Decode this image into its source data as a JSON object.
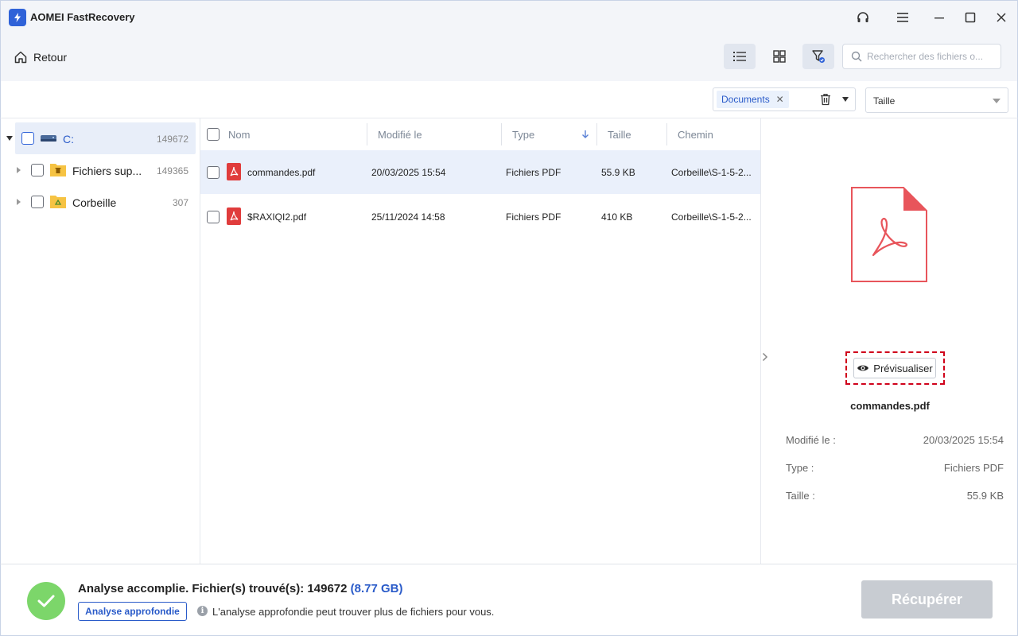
{
  "app": {
    "title": "AOMEI FastRecovery"
  },
  "toolbar": {
    "back_label": "Retour",
    "search_placeholder": "Rechercher des fichiers o..."
  },
  "filter": {
    "chip_label": "Documents",
    "size_select": "Taille"
  },
  "tree": [
    {
      "label": "C:",
      "count": "149672",
      "expanded": true,
      "selected": true
    },
    {
      "label": "Fichiers sup...",
      "count": "149365"
    },
    {
      "label": "Corbeille",
      "count": "307"
    }
  ],
  "columns": {
    "name": "Nom",
    "modified": "Modifié le",
    "type": "Type",
    "size": "Taille",
    "path": "Chemin"
  },
  "files": [
    {
      "name": "commandes.pdf",
      "modified": "20/03/2025 15:54",
      "type": "Fichiers PDF",
      "size": "55.9 KB",
      "path": "Corbeille\\S-1-5-2...",
      "selected": true
    },
    {
      "name": "$RAXIQI2.pdf",
      "modified": "25/11/2024 14:58",
      "type": "Fichiers PDF",
      "size": "410 KB",
      "path": "Corbeille\\S-1-5-2..."
    }
  ],
  "preview": {
    "button_label": "Prévisualiser",
    "file_name": "commandes.pdf",
    "meta": [
      {
        "label": "Modifié le :",
        "value": "20/03/2025 15:54"
      },
      {
        "label": "Type :",
        "value": "Fichiers PDF"
      },
      {
        "label": "Taille :",
        "value": "55.9 KB"
      }
    ]
  },
  "footer": {
    "status": "Analyse accomplie. Fichier(s) trouvé(s): 149672",
    "status_size": "(8.77 GB)",
    "deep_scan_label": "Analyse approfondie",
    "hint": "L'analyse approfondie peut trouver plus de fichiers pour vous.",
    "recover_label": "Récupérer"
  },
  "colors": {
    "accent": "#2f62d8",
    "link": "#2a5bc9",
    "success": "#7cd66a",
    "pdf": "#e03c3c",
    "highlight": "#d0021b"
  }
}
